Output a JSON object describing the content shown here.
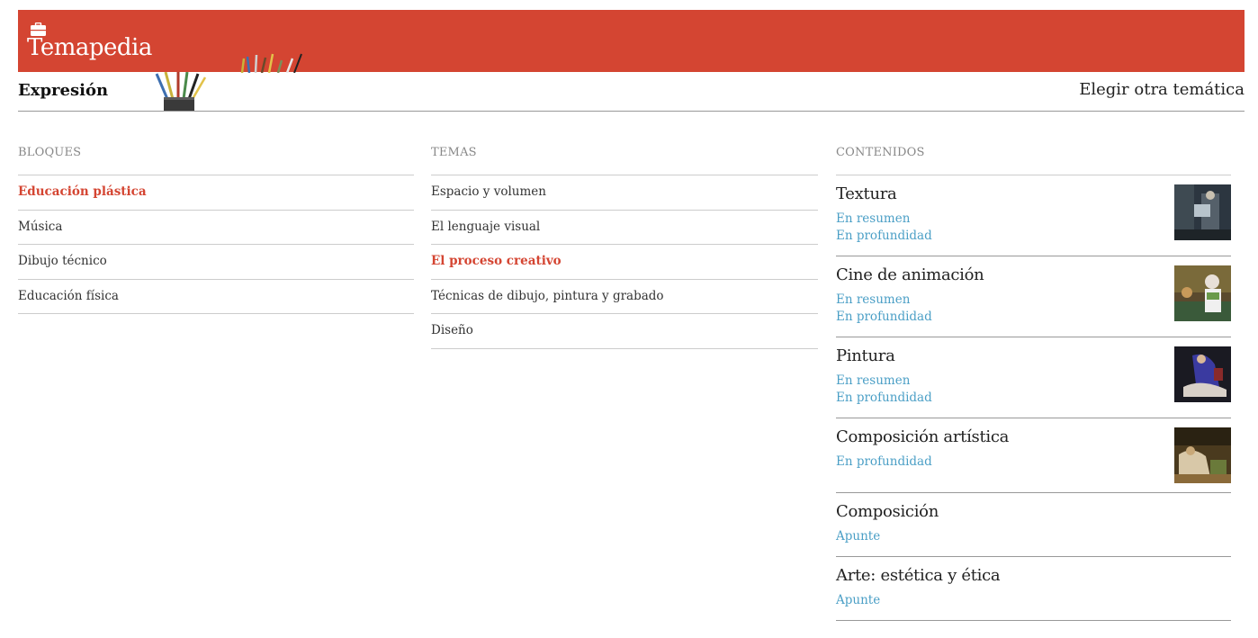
{
  "header": {
    "brand_title": "Temapedia",
    "brand_icon": "briefcase-icon",
    "brand_color": "#d44532"
  },
  "subbar": {
    "section_title": "Expresión",
    "change_topic": "Elegir otra temática"
  },
  "bloques": {
    "heading": "BLOQUES",
    "items": [
      {
        "label": "Educación plástica",
        "active": true
      },
      {
        "label": "Música",
        "active": false
      },
      {
        "label": "Dibujo técnico",
        "active": false
      },
      {
        "label": "Educación física",
        "active": false
      }
    ]
  },
  "temas": {
    "heading": "TEMAS",
    "items": [
      {
        "label": "Espacio y volumen",
        "active": false
      },
      {
        "label": "El lenguaje visual",
        "active": false
      },
      {
        "label": "El proceso creativo",
        "active": true
      },
      {
        "label": "Técnicas de dibujo, pintura y grabado",
        "active": false
      },
      {
        "label": "Diseño",
        "active": false
      }
    ]
  },
  "contenidos": {
    "heading": "CONTENIDOS",
    "items": [
      {
        "title": "Textura",
        "links": [
          "En resumen",
          "En profundidad"
        ]
      },
      {
        "title": "Cine de animación",
        "links": [
          "En resumen",
          "En profundidad"
        ]
      },
      {
        "title": "Pintura",
        "links": [
          "En resumen",
          "En profundidad"
        ]
      },
      {
        "title": "Composición artística",
        "links": [
          "En profundidad"
        ]
      },
      {
        "title": "Composición",
        "links": [
          "Apunte"
        ]
      },
      {
        "title": "Arte: estética y ética",
        "links": [
          "Apunte"
        ]
      }
    ]
  },
  "colors": {
    "accent": "#d44532",
    "link": "#4b9fc6"
  }
}
